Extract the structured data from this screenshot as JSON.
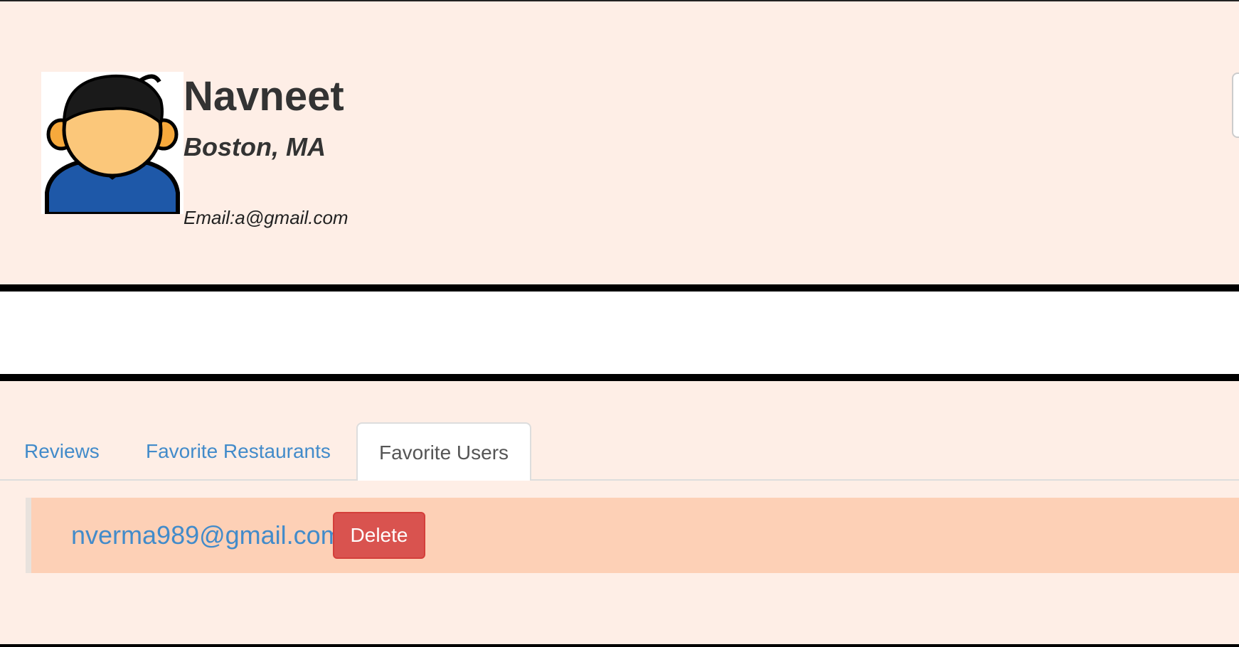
{
  "profile": {
    "avatar_icon": "user-avatar-icon",
    "name": "Navneet",
    "location": "Boston, MA",
    "email": "Email:a@gmail.com"
  },
  "tabs": [
    {
      "label": "Reviews",
      "active": false
    },
    {
      "label": "Favorite Restaurants",
      "active": false
    },
    {
      "label": "Favorite Users",
      "active": true
    }
  ],
  "favorite_users": [
    {
      "email": "nverma989@gmail.com",
      "action_label": "Delete"
    }
  ],
  "colors": {
    "panel_background": "#feeee6",
    "row_background": "#fdd0b6",
    "link": "#428bca",
    "danger": "#d9534f"
  }
}
